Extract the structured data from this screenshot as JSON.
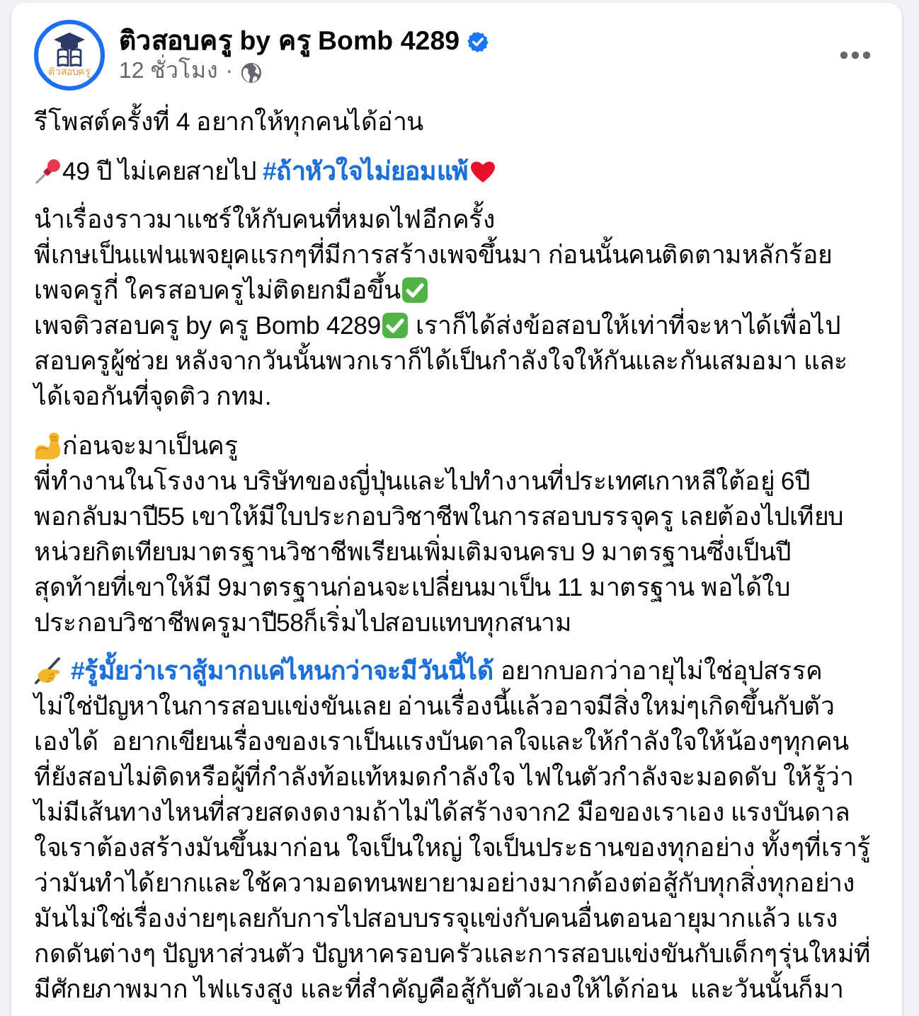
{
  "post": {
    "author": {
      "name": "ติวสอบครู by ครู Bomb 4289",
      "verified": true,
      "avatar_text": "ติวสอบครู"
    },
    "time": "12 ชั่วโมง",
    "separator": "·",
    "paragraphs": [
      {
        "lines": [
          [
            {
              "kind": "text",
              "text": "รีโพสต์ครั้งที่ 4 อยากให้ทุกคนได้อ่าน"
            }
          ]
        ]
      },
      {
        "lines": [
          [
            {
              "kind": "pin"
            },
            {
              "kind": "text",
              "text": "49 ปี ไม่เคยสายไป "
            },
            {
              "kind": "hashtag",
              "text": "#ถ้าหัวใจไม่ยอมแพ้"
            },
            {
              "kind": "heart"
            }
          ]
        ]
      },
      {
        "lines": [
          [
            {
              "kind": "text",
              "text": "นำเรื่องราวมาแชร์ให้กับคนที่หมดไฟอีกครั้ง"
            }
          ],
          [
            {
              "kind": "text",
              "text": "พี่เกษเป็นแฟนเพจยุคแรกๆที่มีการสร้างเพจขึ้นมา ก่อนนั้นคนติดตามหลักร้อย"
            }
          ],
          [
            {
              "kind": "text",
              "text": "เพจครูกี่ ใครสอบครูไม่ติดยกมือขึ้น"
            },
            {
              "kind": "check"
            }
          ],
          [
            {
              "kind": "text",
              "text": "เพจติวสอบครู by ครู Bomb 4289"
            },
            {
              "kind": "check"
            },
            {
              "kind": "text",
              "text": " เราก็ได้ส่งข้อสอบให้เท่าที่จะหาได้เพื่อไป"
            }
          ],
          [
            {
              "kind": "text",
              "text": "สอบครูผู้ช่วย หลังจากวันนั้นพวกเราก็ได้เป็นกำลังใจให้กันและกันเสมอมา และ"
            }
          ],
          [
            {
              "kind": "text",
              "text": "ได้เจอกันที่จุดติว กทม."
            }
          ]
        ]
      },
      {
        "lines": [
          [
            {
              "kind": "muscle"
            },
            {
              "kind": "text",
              "text": "ก่อนจะมาเป็นครู"
            }
          ],
          [
            {
              "kind": "text",
              "text": "พี่ทำงานในโรงงาน บริษัทของญี่ปุ่นและไปทำงานที่ประเทศเกาหลีใต้อยู่ 6ปี"
            }
          ],
          [
            {
              "kind": "text",
              "text": "พอกลับมาปี55 เขาให้มีใบประกอบวิชาชีพในการสอบบรรจุครู เลยต้องไปเทียบ"
            }
          ],
          [
            {
              "kind": "text",
              "text": "หน่วยกิตเทียบมาตรฐานวิชาชีพเรียนเพิ่มเติมจนครบ 9 มาตรฐานซึ่งเป็นปี"
            }
          ],
          [
            {
              "kind": "text",
              "text": "สุดท้ายที่เขาให้มี 9มาตรฐานก่อนจะเปลี่ยนมาเป็น 11 มาตรฐาน พอได้ใบ"
            }
          ],
          [
            {
              "kind": "text",
              "text": "ประกอบวิชาชีพครูมาปี58ก็เริ่มไปสอบแทบทุกสนาม"
            }
          ]
        ]
      },
      {
        "lines": [
          [
            {
              "kind": "writing"
            },
            {
              "kind": "hashtag",
              "text": "#รู้มั้ยว่าเราสู้มากแค่ไหนกว่าจะมีวันนี้ได้"
            },
            {
              "kind": "text",
              "text": " อยากบอกว่าอายุไม่ใช่อุปสรรค"
            }
          ],
          [
            {
              "kind": "text",
              "text": "ไม่ใช่ปัญหาในการสอบแข่งขันเลย อ่านเรื่องนี้แล้วอาจมีสิ่งใหม่ๆเกิดขึ้นกับตัว"
            }
          ],
          [
            {
              "kind": "text",
              "text": "เองได้  อยากเขียนเรื่องของเราเป็นแรงบันดาลใจและให้กำลังใจให้น้องๆทุกคน"
            }
          ],
          [
            {
              "kind": "text",
              "text": "ที่ยังสอบไม่ติดหรือผู้ที่กำลังท้อแท้หมดกำลังใจ ไฟในตัวกำลังจะมอดดับ ให้รู้ว่า"
            }
          ],
          [
            {
              "kind": "text",
              "text": "ไม่มีเส้นทางไหนที่สวยสดงดงามถ้าไม่ได้สร้างจาก2 มือของเราเอง แรงบันดาล"
            }
          ],
          [
            {
              "kind": "text",
              "text": "ใจเราต้องสร้างมันขึ้นมาก่อน ใจเป็นใหญ่ ใจเป็นประธานของทุกอย่าง ทั้งๆที่เรารู้"
            }
          ],
          [
            {
              "kind": "text",
              "text": "ว่ามันทำได้ยากและใช้ความอดทนพยายามอย่างมากต้องต่อสู้กับทุกสิ่งทุกอย่าง"
            }
          ],
          [
            {
              "kind": "text",
              "text": "มันไม่ใช่เรื่องง่ายๆเลยกับการไปสอบบรรจุแข่งกับคนอื่นตอนอายุมากแล้ว แรง"
            }
          ],
          [
            {
              "kind": "text",
              "text": "กดดันต่างๆ ปัญหาส่วนตัว ปัญหาครอบครัวและการสอบแข่งขันกับเด็กๆรุ่นใหม่ที่"
            }
          ],
          [
            {
              "kind": "text",
              "text": "มีศักยภาพมาก ไฟแรงสูง และที่สำคัญคือสู้กับตัวเองให้ได้ก่อน  และวันนั้นก็มา"
            }
          ]
        ]
      }
    ]
  }
}
